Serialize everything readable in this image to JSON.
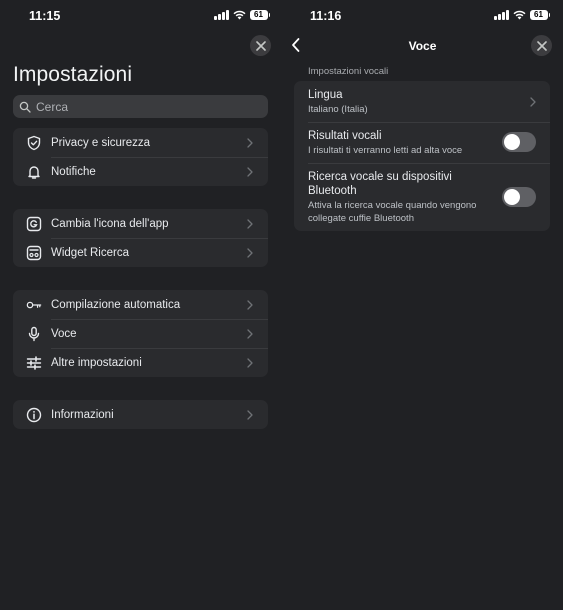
{
  "left": {
    "status": {
      "time": "11:15",
      "battery": "61"
    },
    "title": "Impostazioni",
    "search": {
      "placeholder": "Cerca"
    },
    "groups": [
      {
        "items": [
          {
            "label": "Privacy e sicurezza",
            "icon": "shield-icon"
          },
          {
            "label": "Notifiche",
            "icon": "bell-icon"
          }
        ]
      },
      {
        "items": [
          {
            "label": "Cambia l'icona dell'app",
            "icon": "google-g-icon"
          },
          {
            "label": "Widget Ricerca",
            "icon": "widget-icon"
          }
        ]
      },
      {
        "items": [
          {
            "label": "Compilazione automatica",
            "icon": "key-icon"
          },
          {
            "label": "Voce",
            "icon": "microphone-icon"
          },
          {
            "label": "Altre impostazioni",
            "icon": "sliders-icon"
          }
        ]
      },
      {
        "items": [
          {
            "label": "Informazioni",
            "icon": "info-icon"
          }
        ]
      }
    ]
  },
  "right": {
    "status": {
      "time": "11:16",
      "battery": "61"
    },
    "header": {
      "title": "Voce"
    },
    "section_label": "Impostazioni vocali",
    "rows": [
      {
        "title": "Lingua",
        "subtitle": "Italiano (Italia)"
      },
      {
        "title": "Risultati vocali",
        "subtitle": "I risultati ti verranno letti ad alta voce",
        "toggle": false
      },
      {
        "title": "Ricerca vocale su dispositivi Bluetooth",
        "subtitle": "Attiva la ricerca vocale quando vengono collegate cuffie Bluetooth",
        "toggle": false
      }
    ]
  },
  "colors": {
    "background": "#202124",
    "card": "#2a2b2e",
    "text": "#e8eaed",
    "toggle_off": "#5f6064"
  }
}
